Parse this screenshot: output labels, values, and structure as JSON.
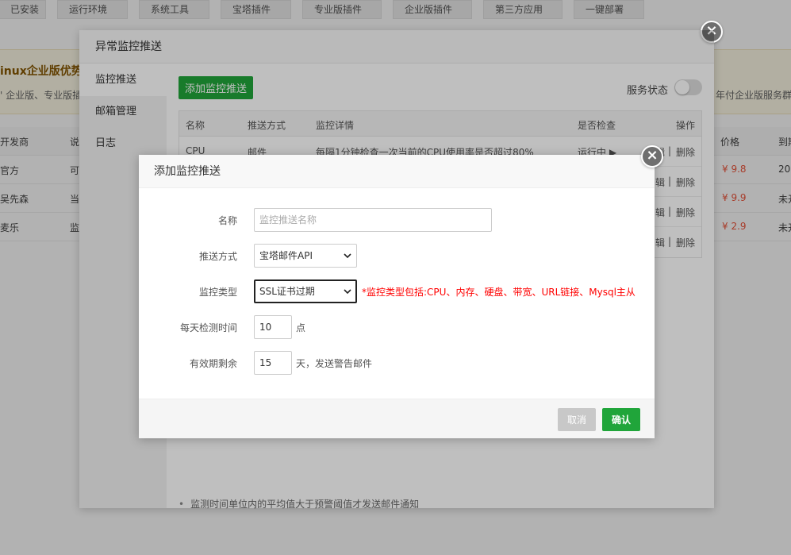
{
  "top_tabs": [
    "已安装",
    "运行环境",
    "系统工具",
    "宝塔插件",
    "专业版插件",
    "企业版插件",
    "第三方应用",
    "一键部署"
  ],
  "promo": {
    "title": "inux企业版优势",
    "subtitle": "' 企业版、专业版插",
    "right_text": "年付企业版服务群"
  },
  "bg_table": {
    "headers": [
      "开发商",
      "说",
      "价格",
      "到期"
    ],
    "rows": [
      {
        "dev": "官方",
        "desc": "可",
        "price": "¥ 9.8",
        "expire": "202"
      },
      {
        "dev": "吴先森",
        "desc": "当",
        "price": "¥ 9.9",
        "expire": "未开"
      },
      {
        "dev": "麦乐",
        "desc": "监",
        "price": "¥ 2.9",
        "expire": "未开"
      }
    ]
  },
  "outer_dialog": {
    "title": "异常监控推送",
    "sidebar": [
      "监控推送",
      "邮箱管理",
      "日志"
    ],
    "add_button": "添加监控推送",
    "service_status_label": "服务状态",
    "table": {
      "headers": [
        "名称",
        "推送方式",
        "监控详情",
        "是否检查",
        "操作"
      ],
      "first_row": {
        "name": "CPU",
        "method": "邮件",
        "detail_prefix": "每隔",
        "detail_interval": "1分钟",
        "detail_middle": "检查一次当前的CPU使用率是否超过",
        "detail_threshold": "80%",
        "status": "运行中 ▶",
        "edit": "编辑",
        "delete": "删除"
      },
      "other_rows": [
        {
          "edit": "辑",
          "delete": "删除"
        },
        {
          "edit": "辑",
          "delete": "删除"
        },
        {
          "edit": "辑",
          "delete": "删除"
        }
      ],
      "separator": "|"
    },
    "note": "监测时间单位内的平均值大于预警阈值才发送邮件通知"
  },
  "inner_dialog": {
    "title": "添加监控推送",
    "name_label": "名称",
    "name_placeholder": "监控推送名称",
    "method_label": "推送方式",
    "method_value": "宝塔邮件API",
    "type_label": "监控类型",
    "type_value": "SSL证书过期",
    "type_hint": "*监控类型包括:CPU、内存、硬盘、带宽、URL链接、Mysql主从",
    "time_label": "每天检测时间",
    "time_value": "10",
    "time_unit": "点",
    "expire_label": "有效期剩余",
    "expire_value": "15",
    "expire_unit": "天，发送警告邮件",
    "cancel": "取消",
    "confirm": "确认"
  },
  "icons": {
    "close": "×"
  },
  "colors": {
    "accent_green": "#20a53a",
    "hint_red": "#ff0000",
    "price_orange": "#f0553b"
  }
}
